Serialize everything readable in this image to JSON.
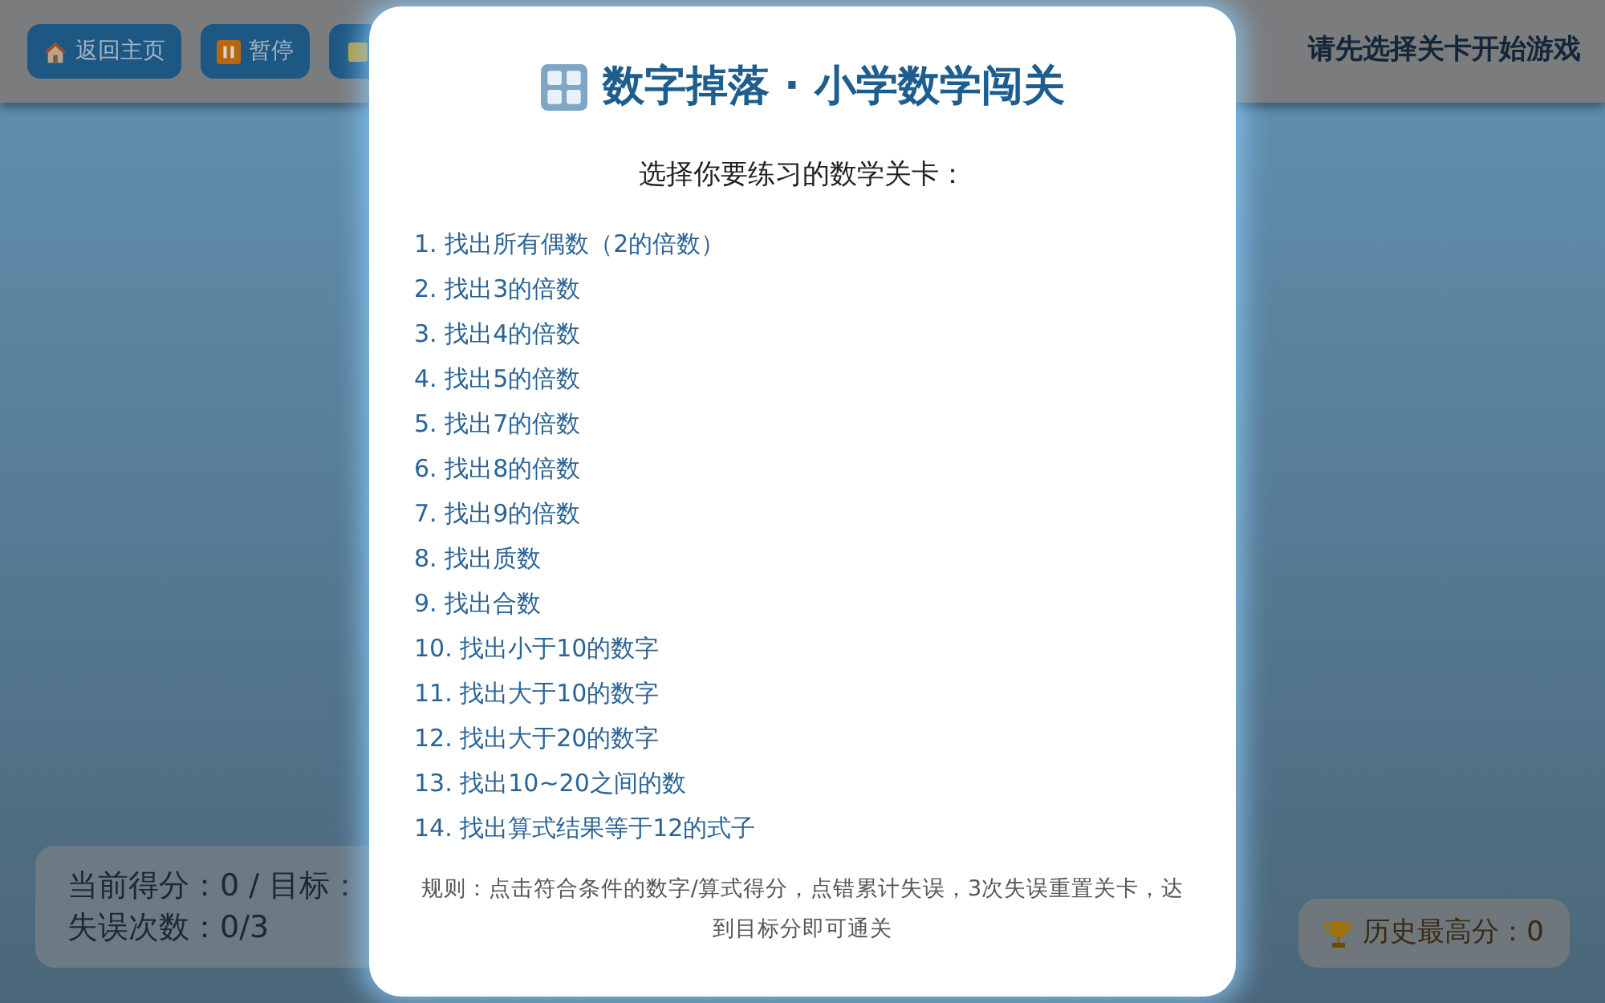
{
  "header": {
    "buttons": [
      {
        "kind": "home",
        "label": "返回主页"
      },
      {
        "kind": "pause",
        "label": "暂停"
      },
      {
        "kind": "tile"
      }
    ],
    "status": "请先选择关卡开始游戏"
  },
  "score_panel": {
    "score_line": "当前得分：0 / 目标：",
    "mistakes_line": "失误次数：0/3"
  },
  "best_score": {
    "text": "历史最高分：0"
  },
  "dialog": {
    "title": "数字掉落 · 小学数学闯关",
    "prompt": "选择你要练习的数学关卡：",
    "levels": [
      "1. 找出所有偶数（2的倍数）",
      "2. 找出3的倍数",
      "3. 找出4的倍数",
      "4. 找出5的倍数",
      "5. 找出7的倍数",
      "6. 找出8的倍数",
      "7. 找出9的倍数",
      "8. 找出质数",
      "9. 找出合数",
      "10. 找出小于10的数字",
      "11. 找出大于10的数字",
      "12. 找出大于20的数字",
      "13. 找出10~20之间的数",
      "14. 找出算式结果等于12的式子"
    ],
    "rules": "规则：点击符合条件的数字/算式得分，点错累计失误，3次失误重置关卡，达到目标分即可通关"
  }
}
